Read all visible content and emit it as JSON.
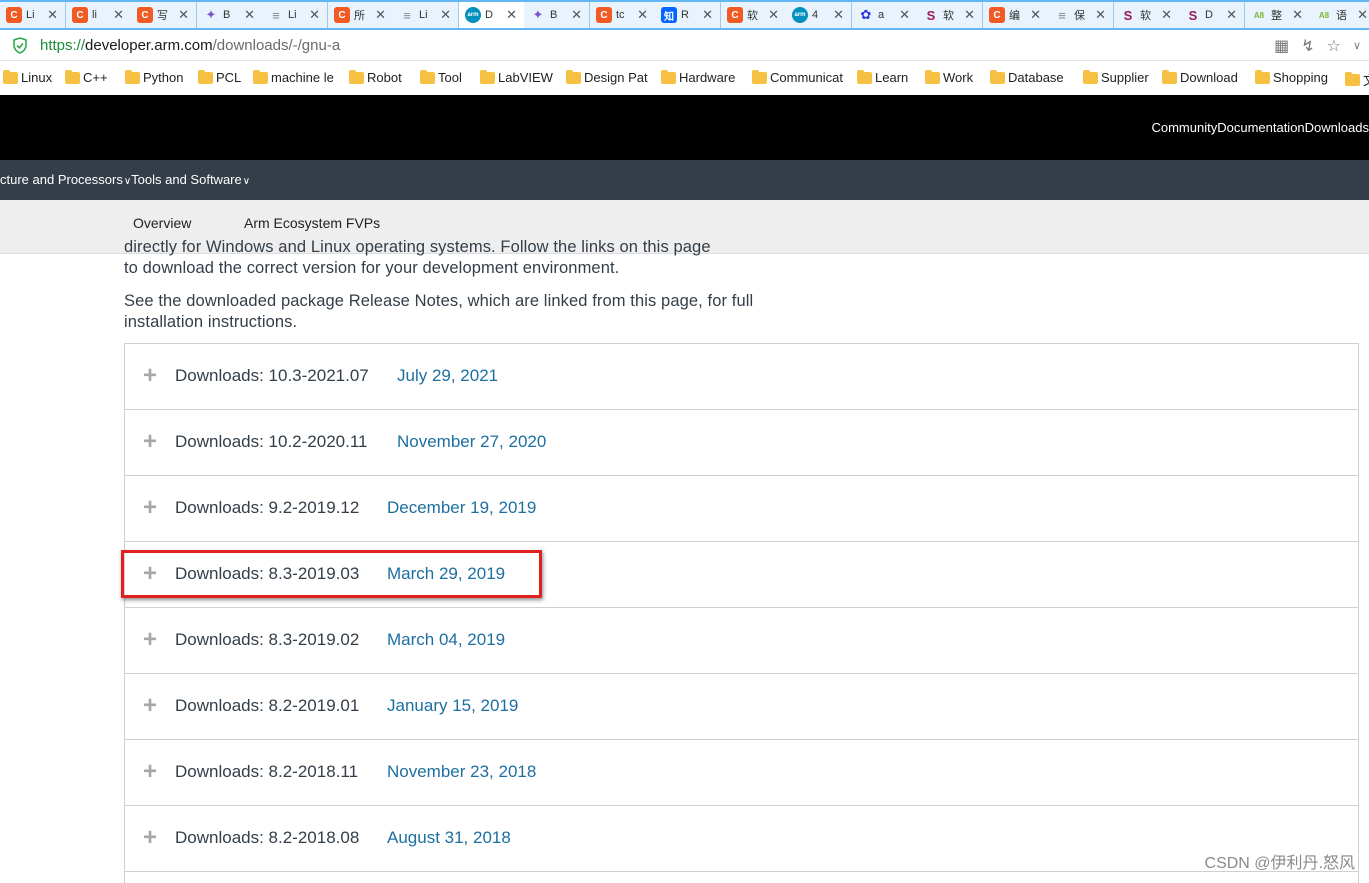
{
  "browser": {
    "tabs": [
      {
        "icon": "csdn-icon",
        "color": "#f15a22",
        "glyph": "C",
        "title": "Li"
      },
      {
        "icon": "csdn-icon",
        "color": "#f15a22",
        "glyph": "C",
        "title": "li"
      },
      {
        "icon": "csdn-icon",
        "color": "#f15a22",
        "glyph": "C",
        "title": "写"
      },
      {
        "icon": "colorful-icon",
        "color": "#7d55c7",
        "glyph": "✦",
        "title": "B"
      },
      {
        "icon": "document-icon",
        "color": "#888888",
        "glyph": "≡",
        "title": "Li"
      },
      {
        "icon": "csdn-icon",
        "color": "#f15a22",
        "glyph": "C",
        "title": "所"
      },
      {
        "icon": "document-icon",
        "color": "#888888",
        "glyph": "≡",
        "title": "Li"
      },
      {
        "icon": "arm-icon",
        "color": "#0091bd",
        "glyph": "arm",
        "title": "D"
      },
      {
        "icon": "colorful-icon",
        "color": "#7d55c7",
        "glyph": "✦",
        "title": "B"
      },
      {
        "icon": "csdn-icon",
        "color": "#f15a22",
        "glyph": "C",
        "title": "tc"
      },
      {
        "icon": "zhihu-icon",
        "color": "#0066ff",
        "glyph": "知",
        "title": "R"
      },
      {
        "icon": "csdn-icon",
        "color": "#f15a22",
        "glyph": "C",
        "title": "软"
      },
      {
        "icon": "arm-icon",
        "color": "#0091bd",
        "glyph": "arm",
        "title": "4"
      },
      {
        "icon": "baidu-icon",
        "color": "#2932e1",
        "glyph": "✿",
        "title": "a"
      },
      {
        "icon": "s-logo-icon",
        "color": "#9b1b5a",
        "glyph": "S",
        "title": "软"
      },
      {
        "icon": "csdn-icon",
        "color": "#f15a22",
        "glyph": "C",
        "title": "编"
      },
      {
        "icon": "document-icon",
        "color": "#888888",
        "glyph": "≡",
        "title": "保"
      },
      {
        "icon": "s-logo-icon",
        "color": "#9b1b5a",
        "glyph": "S",
        "title": "软"
      },
      {
        "icon": "s-logo-icon",
        "color": "#9b1b5a",
        "glyph": "S",
        "title": "D"
      },
      {
        "icon": "a8-icon",
        "color": "#7fb52f",
        "glyph": "A8",
        "title": "整"
      },
      {
        "icon": "a8-icon",
        "color": "#7fb52f",
        "glyph": "A8",
        "title": "语"
      }
    ],
    "active_tab": 7,
    "url": {
      "scheme": "https://",
      "host": "developer.arm.com",
      "path": "/downloads/-/gnu-a"
    },
    "bookmarks": [
      "Linux",
      "C++",
      "Python",
      "PCL",
      "machine le",
      "Robot",
      "Tool",
      "LabVIEW",
      "Design Pat",
      "Hardware",
      "Communicat",
      "Learn",
      "Work",
      "Database",
      "Supplier",
      "Download",
      "Shopping",
      "文"
    ]
  },
  "site": {
    "top_nav": [
      "Community",
      "Documentation",
      "Downloads"
    ],
    "main_nav": [
      {
        "label": "cture and Processors"
      },
      {
        "label": "Tools and Software"
      }
    ],
    "chevron": "∨",
    "sub_nav": [
      "Overview",
      "Arm Ecosystem FVPs"
    ]
  },
  "content": {
    "para1_line1": "directly for Windows and Linux operating systems. Follow the links on this page",
    "para1_line2": "to download the correct version for your development environment.",
    "para2": "See the downloaded package Release Notes, which are linked from this page, for full installation instructions.",
    "plus": "+",
    "downloads": [
      {
        "label": "Downloads: 10.3-2021.07",
        "date": "July 29, 2021"
      },
      {
        "label": "Downloads: 10.2-2020.11",
        "date": "November 27, 2020"
      },
      {
        "label": "Downloads: 9.2-2019.12",
        "date": "December 19, 2019"
      },
      {
        "label": "Downloads: 8.3-2019.03",
        "date": "March 29, 2019"
      },
      {
        "label": "Downloads: 8.3-2019.02",
        "date": "March 04, 2019"
      },
      {
        "label": "Downloads: 8.2-2019.01",
        "date": "January 15, 2019"
      },
      {
        "label": "Downloads: 8.2-2018.11",
        "date": "November 23, 2018"
      },
      {
        "label": "Downloads: 8.2-2018.08",
        "date": "August 31, 2018"
      }
    ],
    "highlighted_index": 3
  },
  "watermark": "CSDN @伊利丹.怒风",
  "colors": {
    "tab_strip": "#62b6f4",
    "header_black": "#000000",
    "nav_dark": "#333e48",
    "link_blue": "#1d6fa0",
    "highlight_red": "#e0211f"
  }
}
